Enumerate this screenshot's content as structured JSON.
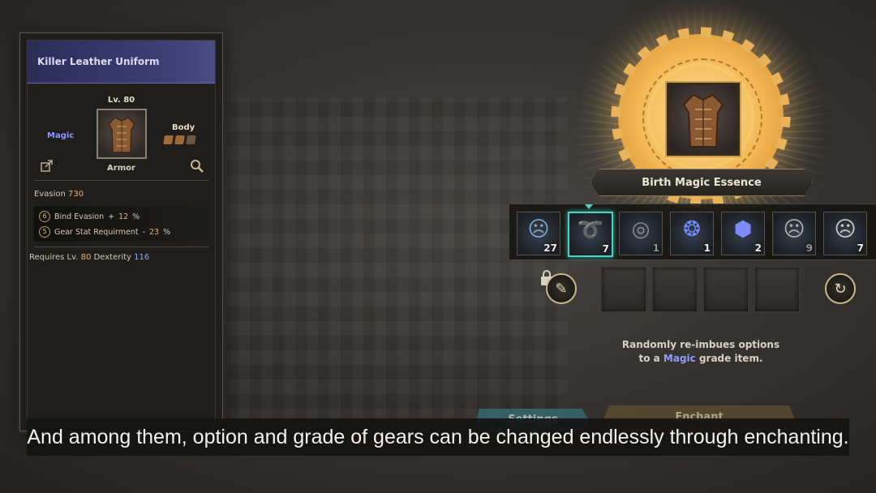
{
  "item": {
    "name": "Killer Leather Uniform",
    "level": "Lv. 80",
    "grade": "Magic",
    "slot": "Body",
    "type": "Armor",
    "base_stat": {
      "label": "Evasion",
      "value": "730"
    },
    "options": [
      {
        "badge": "6",
        "label": "Bind Evasion",
        "sign": "+",
        "value": "12",
        "unit": "%"
      },
      {
        "badge": "5",
        "label": "Gear Stat Requirment",
        "sign": "-",
        "value": "23",
        "unit": "%"
      }
    ],
    "requirements": {
      "label": "Requires Lv.",
      "level": "80",
      "stat_label": "Dexterity",
      "stat_value": "116"
    }
  },
  "enchant": {
    "selected_material": "Birth Magic Essence",
    "materials": [
      {
        "name": "spirit-face-material",
        "count": "27",
        "glyph": "☹",
        "color": "#7fa6cf",
        "dim": false
      },
      {
        "name": "serpent-essence",
        "count": "7",
        "glyph": "➰",
        "color": "#9a8cff",
        "dim": false,
        "selected": true
      },
      {
        "name": "gray-orb-material",
        "count": "1",
        "glyph": "◎",
        "color": "#8e8a86",
        "dim": true
      },
      {
        "name": "rune-ring-material",
        "count": "1",
        "glyph": "❂",
        "color": "#6f8dff",
        "dim": false
      },
      {
        "name": "rune-cube-material",
        "count": "2",
        "glyph": "⬢",
        "color": "#7c8cff",
        "dim": false
      },
      {
        "name": "pale-face-material",
        "count": "9",
        "glyph": "☹",
        "color": "#b5b1aa",
        "dim": true
      },
      {
        "name": "silver-face-material",
        "count": "7",
        "glyph": "☹",
        "color": "#cfcac2",
        "dim": false
      }
    ],
    "description_line1": "Randomly re-imbues options",
    "description_pre": "to a ",
    "description_grade": "Magic",
    "description_post": " grade item.",
    "settings_label": "Settings",
    "enchant_label": "Enchant"
  },
  "subtitle": "And among them, option and grade of gears can be changed endlessly through enchanting."
}
